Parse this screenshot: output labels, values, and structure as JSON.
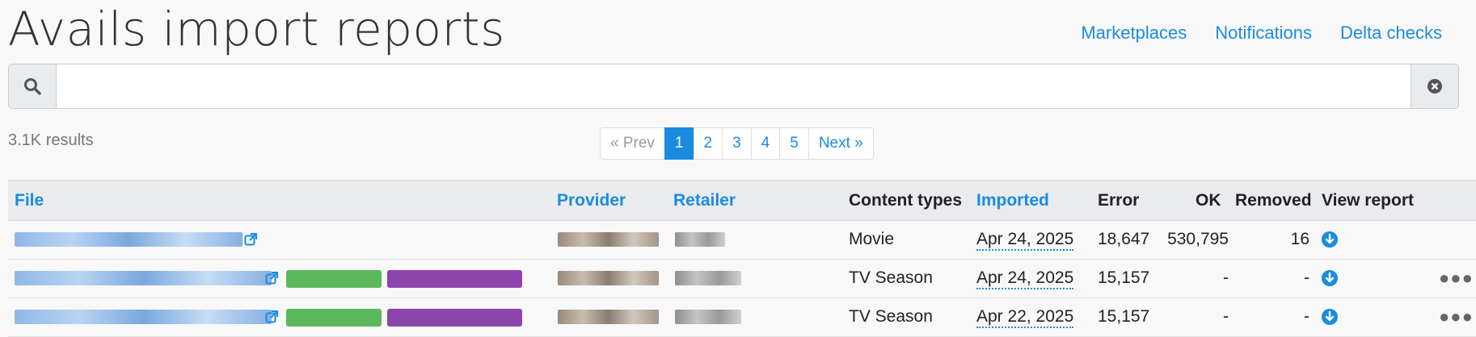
{
  "page": {
    "title": "Avails import reports"
  },
  "topnav": [
    {
      "label": "Marketplaces"
    },
    {
      "label": "Notifications"
    },
    {
      "label": "Delta checks"
    }
  ],
  "search": {
    "value": "",
    "placeholder": ""
  },
  "results_count": "3.1K results",
  "pagination": {
    "prev": "« Prev",
    "pages": [
      "1",
      "2",
      "3",
      "4",
      "5"
    ],
    "active": "1",
    "next": "Next »"
  },
  "table": {
    "headers": {
      "file": "File",
      "provider": "Provider",
      "retailer": "Retailer",
      "content_types": "Content types",
      "imported": "Imported",
      "error": "Error",
      "ok": "OK",
      "removed": "Removed",
      "view_report": "View report"
    },
    "rows": [
      {
        "content_type": "Movie",
        "imported": "Apr 24, 2025",
        "error": "18,647",
        "ok": "530,795",
        "removed": "16"
      },
      {
        "content_type": "TV Season",
        "imported": "Apr 24, 2025",
        "error": "15,157",
        "ok": "-",
        "removed": "-"
      },
      {
        "content_type": "TV Season",
        "imported": "Apr 22, 2025",
        "error": "15,157",
        "ok": "-",
        "removed": "-"
      }
    ]
  },
  "icons": {
    "search": "search-icon",
    "clear": "times-circle-icon",
    "external": "external-link-icon",
    "download": "arrow-circle-down-icon",
    "more": "ellipsis-icon"
  },
  "colors": {
    "accent": "#1a8ce0",
    "tag_green": "#5cb85c",
    "tag_purple": "#8e44ad"
  }
}
